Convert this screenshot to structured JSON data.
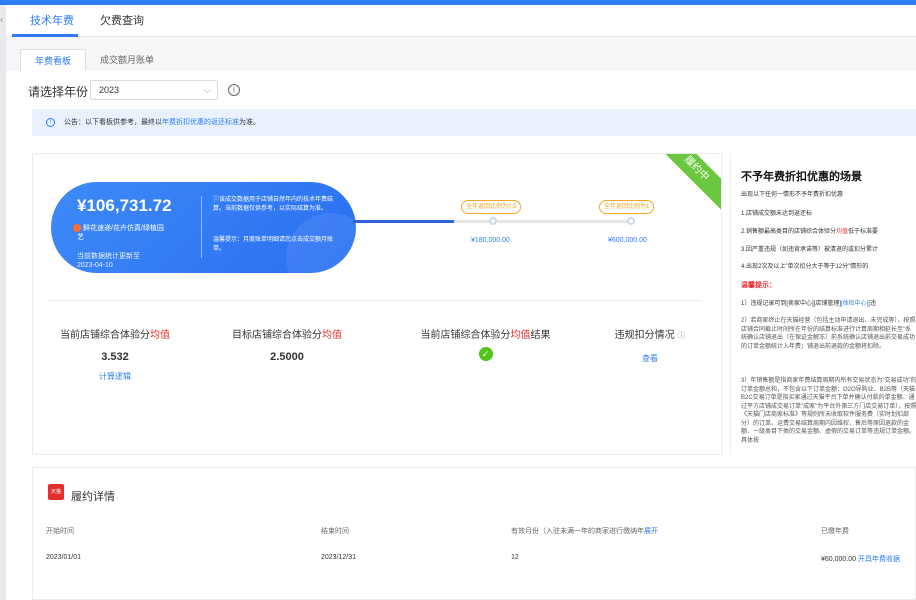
{
  "tabs": [
    {
      "label": "技术年费",
      "active": true
    },
    {
      "label": "欠费查询",
      "active": false
    }
  ],
  "subtabs": [
    {
      "label": "年费看板",
      "active": true
    },
    {
      "label": "成交额月账单",
      "active": false
    }
  ],
  "year_filter": {
    "label": "请选择年份",
    "value": "2023"
  },
  "notice": {
    "prefix": "公告：以下看板供参考，最终以",
    "highlight": "年费折扣优惠的返还标准",
    "suffix": "为准。"
  },
  "fulfillment_card": {
    "ribbon": "履约中",
    "amount": "¥106,731.72",
    "seller_line1": "鲜花速递/花卉仿真/绿植园",
    "seller_line2": "艺",
    "updated_label": "当前数据统计更新至",
    "updated_date": "2023-04-10",
    "note1": "ⓘ该成交数据用于店铺自然年内的技术年费结算。当前数据仅供参考，以实际结算为准。",
    "note2": "温馨提示：月度账单明细请您点击成交额月账单。",
    "progress_fraction": 0.36,
    "tiers": [
      {
        "label": "全年返回比例为0.5",
        "amount": "¥180,000.00"
      },
      {
        "label": "全年返回比例为1",
        "amount": "¥600,000.00"
      }
    ]
  },
  "stats": [
    {
      "label_pre": "当前店铺综合体验分",
      "label_red": "均值",
      "label_post": "",
      "value": "3.532",
      "link": "计算逻辑"
    },
    {
      "label_pre": "目标店铺综合体验分",
      "label_red": "均值",
      "label_post": "",
      "value": "2.5000",
      "link": ""
    },
    {
      "label_pre": "当前店铺综合体验分",
      "label_red": "均值",
      "label_post": "结果",
      "value": "",
      "link": ""
    },
    {
      "label_pre": "违规扣分情况",
      "label_red": "",
      "label_post": "",
      "value": "",
      "link": "查看"
    }
  ],
  "side": {
    "title": "不予年费折扣优惠的场景",
    "intro": "出现以下任何一情形不予年费折扣优惠",
    "items": [
      "1.店铺成交额未达到返还标",
      "2.销售额最高类目的店铺综合体验分",
      "3.因严重违规（如违背承诺等）被清退的或扣分累计",
      "4.出现2次及以上\"单次扣分大于等于12分\"情形的"
    ],
    "item2_red": "均值",
    "item2_tail": "低于标准要",
    "warn_title": "温馨提示：",
    "warn1_pre": "1）违规记录可到[卖家中心][店铺管理]",
    "warn1_blue": "[体检中心]",
    "warn1_post": "[违",
    "warn2": "2）若商家终止在天猫经营（包括主动申请退出、未完成等），按照店铺合同截止时间所在年份的结算标准进行计算周期相延长至\"系统确认店铺退出（在保证金解冻）前系统确认店铺退出前交易成功的订单金额统计入年费；铺退出前退款的金额将扣除。",
    "warn3": "3）年销售额是指商家年费结算周期内所有交易状态为\"交易成功\"的订单金额总和，不包含以下订单金额：O2O导购业、B2B等（天猫B2C交易订单是指买家通过天猫平台下单并确认付款的单金额、通过平方店铺成交易订单\"成家\"为平台外第三方门店交易订单），按照《天猫门店商家标准》等规则所未收取软件服务费（实时划扣部分）的订单、运费交易结算周期内因维权、售后等原因退款的金额、一级类目下类的交易金额、虚假的交易订单等违规订单金额。具体按"
  },
  "detail": {
    "title": "履约详情",
    "tmall_badge": "天猫",
    "columns": [
      "开始时间",
      "结束时间",
      "有效月份（入驻未满一年的商家进行缴纳年",
      "已缴年费"
    ],
    "expand_link": "展开",
    "row": {
      "start": "2023/01/01",
      "end": "2023/12/31",
      "months": "12",
      "paid": "¥60,000.00",
      "receipt_link": "开具年费收据"
    }
  }
}
